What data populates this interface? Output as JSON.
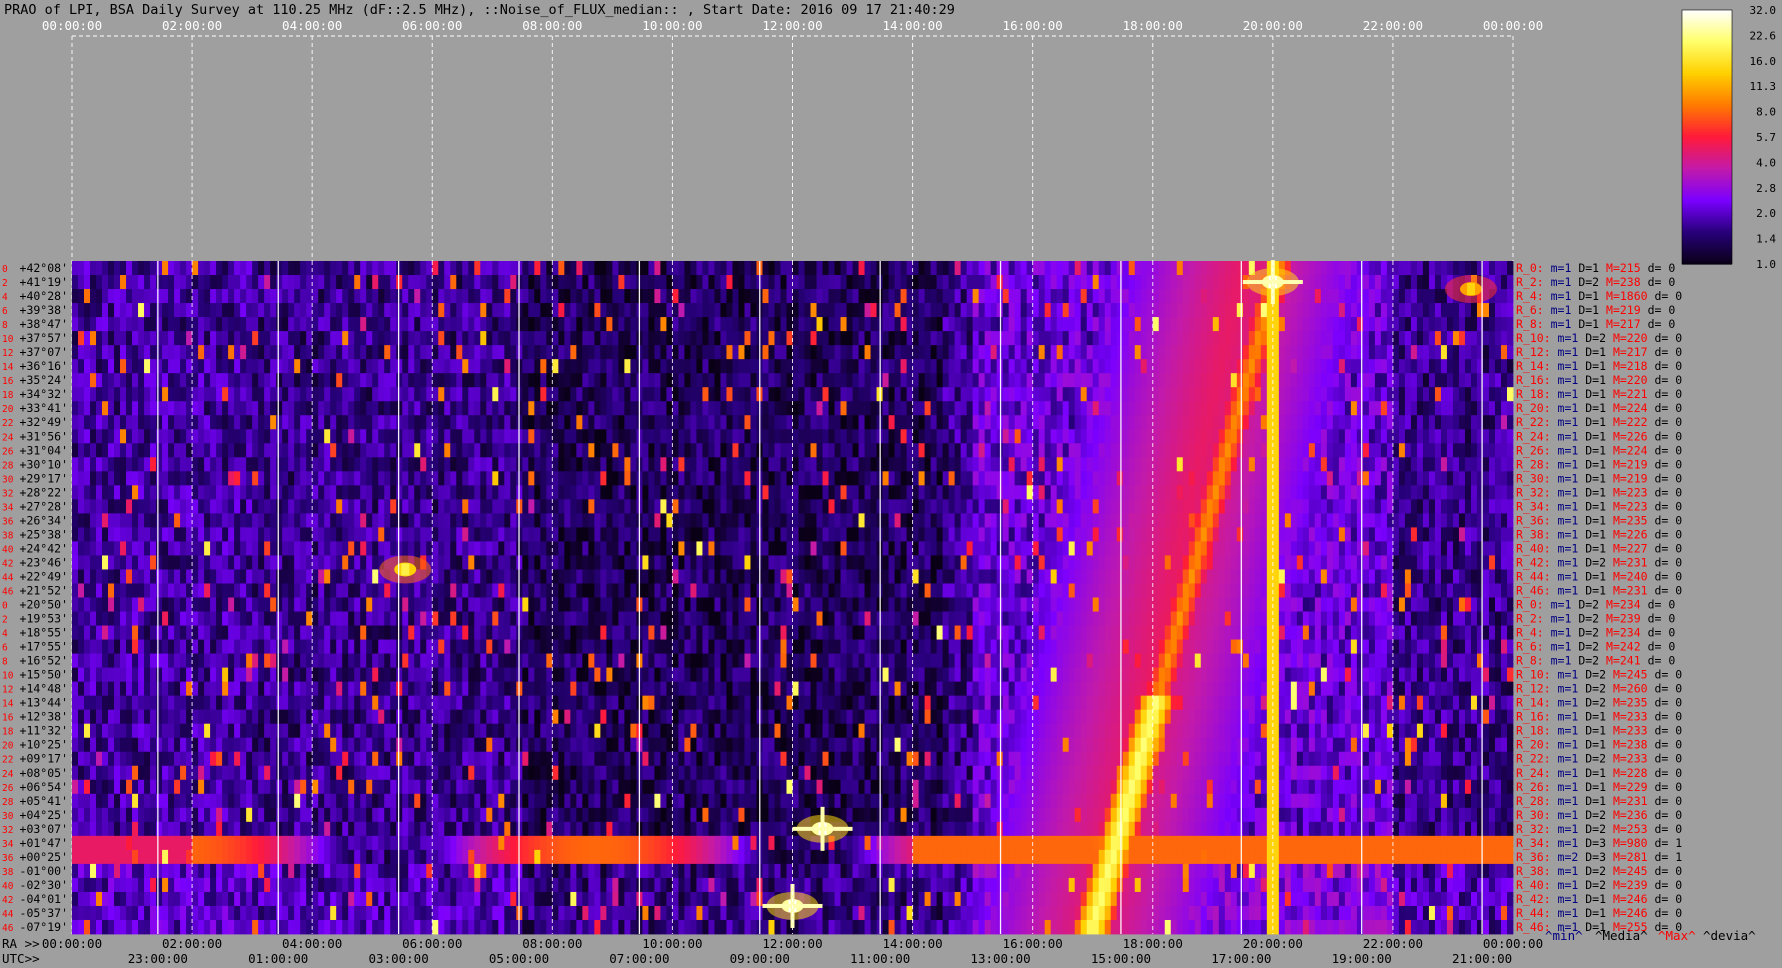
{
  "chart_data": {
    "type": "heatmap",
    "title": "PRAO of LPI, BSA Daily Survey at 110.25 MHz (dF::2.5 MHz), ::Noise_of_FLUX_median:: , Start Date: 2016 09 17 21:40:29",
    "top_ticks": [
      "00:00:00",
      "02:00:00",
      "04:00:00",
      "06:00:00",
      "08:00:00",
      "10:00:00",
      "12:00:00",
      "14:00:00",
      "16:00:00",
      "18:00:00",
      "20:00:00",
      "22:00:00",
      "00:00:00"
    ],
    "ra_label": "RA >>",
    "ra_ticks": [
      "00:00:00",
      "02:00:00",
      "04:00:00",
      "06:00:00",
      "08:00:00",
      "10:00:00",
      "12:00:00",
      "14:00:00",
      "16:00:00",
      "18:00:00",
      "20:00:00",
      "22:00:00",
      "00:00:00"
    ],
    "utc_label": "UTC>>",
    "utc_ticks": [
      "23:00:00",
      "01:00:00",
      "03:00:00",
      "05:00:00",
      "07:00:00",
      "09:00:00",
      "11:00:00",
      "13:00:00",
      "15:00:00",
      "17:00:00",
      "19:00:00",
      "21:00:00"
    ],
    "colorbar": {
      "ticks": [
        "32.0",
        "22.6",
        "16.0",
        "11.3",
        "8.0",
        "5.7",
        "4.0",
        "2.8",
        "2.0",
        "1.4",
        "1.0"
      ],
      "range": [
        1.0,
        32.0
      ],
      "scale": "log",
      "colors": [
        "#0a0016",
        "#27007a",
        "#7a00ff",
        "#c21aaa",
        "#ff1a3a",
        "#ff7a00",
        "#ffd000",
        "#ffff6a",
        "#ffffff"
      ]
    },
    "declinations": [
      "+42°08'",
      "+41°19'",
      "+40°28'",
      "+39°38'",
      "+38°47'",
      "+37°57'",
      "+37°07'",
      "+36°16'",
      "+35°24'",
      "+34°32'",
      "+33°41'",
      "+32°49'",
      "+31°56'",
      "+31°04'",
      "+30°10'",
      "+29°17'",
      "+28°22'",
      "+27°28'",
      "+26°34'",
      "+25°38'",
      "+24°42'",
      "+23°46'",
      "+22°49'",
      "+21°52'",
      "+20°50'",
      "+19°53'",
      "+18°55'",
      "+17°55'",
      "+16°52'",
      "+15°50'",
      "+14°48'",
      "+13°44'",
      "+12°38'",
      "+11°32'",
      "+10°25'",
      "+09°17'",
      "+08°05'",
      "+06°54'",
      "+05°41'",
      "+04°25'",
      "+03°07'",
      "+01°47'",
      "+00°25'",
      "-01°00'",
      "-02°30'",
      "-04°01'",
      "-05°37'",
      "-07°19'"
    ],
    "row_numbers": [
      "0",
      "2",
      "4",
      "6",
      "8",
      "10",
      "12",
      "14",
      "16",
      "18",
      "20",
      "22",
      "24",
      "26",
      "28",
      "30",
      "32",
      "34",
      "36",
      "38",
      "40",
      "42",
      "44",
      "46",
      "0",
      "2",
      "4",
      "6",
      "8",
      "10",
      "12",
      "14",
      "16",
      "18",
      "20",
      "22",
      "24",
      "26",
      "28",
      "30",
      "32",
      "34",
      "36",
      "38",
      "40",
      "42",
      "44",
      "46"
    ],
    "row_stats": [
      {
        "r": "R_0:",
        "m": "m=1",
        "d": "D=1",
        "M": "M=215",
        "dd": "d= 0"
      },
      {
        "r": "R_2:",
        "m": "m=1",
        "d": "D=2",
        "M": "M=238",
        "dd": "d= 0"
      },
      {
        "r": "R_4:",
        "m": "m=1",
        "d": "D=1",
        "M": "M=1860",
        "dd": "d= 0"
      },
      {
        "r": "R_6:",
        "m": "m=1",
        "d": "D=1",
        "M": "M=219",
        "dd": "d= 0"
      },
      {
        "r": "R_8:",
        "m": "m=1",
        "d": "D=1",
        "M": "M=217",
        "dd": "d= 0"
      },
      {
        "r": "R_10:",
        "m": "m=1",
        "d": "D=2",
        "M": "M=220",
        "dd": "d= 0"
      },
      {
        "r": "R_12:",
        "m": "m=1",
        "d": "D=1",
        "M": "M=217",
        "dd": "d= 0"
      },
      {
        "r": "R_14:",
        "m": "m=1",
        "d": "D=1",
        "M": "M=218",
        "dd": "d= 0"
      },
      {
        "r": "R_16:",
        "m": "m=1",
        "d": "D=1",
        "M": "M=220",
        "dd": "d= 0"
      },
      {
        "r": "R_18:",
        "m": "m=1",
        "d": "D=1",
        "M": "M=221",
        "dd": "d= 0"
      },
      {
        "r": "R_20:",
        "m": "m=1",
        "d": "D=1",
        "M": "M=224",
        "dd": "d= 0"
      },
      {
        "r": "R_22:",
        "m": "m=1",
        "d": "D=1",
        "M": "M=222",
        "dd": "d= 0"
      },
      {
        "r": "R_24:",
        "m": "m=1",
        "d": "D=1",
        "M": "M=226",
        "dd": "d= 0"
      },
      {
        "r": "R_26:",
        "m": "m=1",
        "d": "D=1",
        "M": "M=224",
        "dd": "d= 0"
      },
      {
        "r": "R_28:",
        "m": "m=1",
        "d": "D=1",
        "M": "M=219",
        "dd": "d= 0"
      },
      {
        "r": "R_30:",
        "m": "m=1",
        "d": "D=1",
        "M": "M=219",
        "dd": "d= 0"
      },
      {
        "r": "R_32:",
        "m": "m=1",
        "d": "D=1",
        "M": "M=223",
        "dd": "d= 0"
      },
      {
        "r": "R_34:",
        "m": "m=1",
        "d": "D=1",
        "M": "M=223",
        "dd": "d= 0"
      },
      {
        "r": "R_36:",
        "m": "m=1",
        "d": "D=1",
        "M": "M=235",
        "dd": "d= 0"
      },
      {
        "r": "R_38:",
        "m": "m=1",
        "d": "D=1",
        "M": "M=226",
        "dd": "d= 0"
      },
      {
        "r": "R_40:",
        "m": "m=1",
        "d": "D=1",
        "M": "M=227",
        "dd": "d= 0"
      },
      {
        "r": "R_42:",
        "m": "m=1",
        "d": "D=2",
        "M": "M=231",
        "dd": "d= 0"
      },
      {
        "r": "R_44:",
        "m": "m=1",
        "d": "D=1",
        "M": "M=240",
        "dd": "d= 0"
      },
      {
        "r": "R_46:",
        "m": "m=1",
        "d": "D=1",
        "M": "M=231",
        "dd": "d= 0"
      },
      {
        "r": "R_0:",
        "m": "m=1",
        "d": "D=2",
        "M": "M=234",
        "dd": "d= 0"
      },
      {
        "r": "R_2:",
        "m": "m=1",
        "d": "D=2",
        "M": "M=239",
        "dd": "d= 0"
      },
      {
        "r": "R_4:",
        "m": "m=1",
        "d": "D=2",
        "M": "M=234",
        "dd": "d= 0"
      },
      {
        "r": "R_6:",
        "m": "m=1",
        "d": "D=2",
        "M": "M=242",
        "dd": "d= 0"
      },
      {
        "r": "R_8:",
        "m": "m=1",
        "d": "D=2",
        "M": "M=241",
        "dd": "d= 0"
      },
      {
        "r": "R_10:",
        "m": "m=1",
        "d": "D=2",
        "M": "M=245",
        "dd": "d= 0"
      },
      {
        "r": "R_12:",
        "m": "m=1",
        "d": "D=2",
        "M": "M=260",
        "dd": "d= 0"
      },
      {
        "r": "R_14:",
        "m": "m=1",
        "d": "D=2",
        "M": "M=235",
        "dd": "d= 0"
      },
      {
        "r": "R_16:",
        "m": "m=1",
        "d": "D=1",
        "M": "M=233",
        "dd": "d= 0"
      },
      {
        "r": "R_18:",
        "m": "m=1",
        "d": "D=1",
        "M": "M=233",
        "dd": "d= 0"
      },
      {
        "r": "R_20:",
        "m": "m=1",
        "d": "D=1",
        "M": "M=238",
        "dd": "d= 0"
      },
      {
        "r": "R_22:",
        "m": "m=1",
        "d": "D=2",
        "M": "M=233",
        "dd": "d= 0"
      },
      {
        "r": "R_24:",
        "m": "m=1",
        "d": "D=1",
        "M": "M=228",
        "dd": "d= 0"
      },
      {
        "r": "R_26:",
        "m": "m=1",
        "d": "D=1",
        "M": "M=229",
        "dd": "d= 0"
      },
      {
        "r": "R_28:",
        "m": "m=1",
        "d": "D=1",
        "M": "M=231",
        "dd": "d= 0"
      },
      {
        "r": "R_30:",
        "m": "m=1",
        "d": "D=2",
        "M": "M=236",
        "dd": "d= 0"
      },
      {
        "r": "R_32:",
        "m": "m=1",
        "d": "D=2",
        "M": "M=253",
        "dd": "d= 0"
      },
      {
        "r": "R_34:",
        "m": "m=1",
        "d": "D=3",
        "M": "M=980",
        "dd": "d= 1"
      },
      {
        "r": "R_36:",
        "m": "m=2",
        "d": "D=3",
        "M": "M=281",
        "dd": "d= 1"
      },
      {
        "r": "R_38:",
        "m": "m=1",
        "d": "D=2",
        "M": "M=245",
        "dd": "d= 0"
      },
      {
        "r": "R_40:",
        "m": "m=1",
        "d": "D=2",
        "M": "M=239",
        "dd": "d= 0"
      },
      {
        "r": "R_42:",
        "m": "m=1",
        "d": "D=1",
        "M": "M=246",
        "dd": "d= 0"
      },
      {
        "r": "R_44:",
        "m": "m=1",
        "d": "D=1",
        "M": "M=246",
        "dd": "d= 0"
      },
      {
        "r": "R_46:",
        "m": "m=1",
        "d": "D=1",
        "M": "M=255",
        "dd": "d= 0"
      }
    ],
    "legend": [
      "^min^",
      "^Media^",
      "^Max^",
      "^devia^"
    ],
    "colors": {
      "background": "#9f9f9f",
      "stat_red": "#ff0000",
      "stat_blue": "#000080",
      "row_number": "#ff0000"
    },
    "features": [
      {
        "name": "horizontal source band",
        "dec_rows": [
          41,
          42
        ],
        "ra_start_h": 0.0,
        "ra_end_h": 24.0,
        "intensity": 8
      },
      {
        "name": "Cygnus track",
        "ra_h": 20.0,
        "dec_rows": [
          0,
          47
        ],
        "intensity": 14
      },
      {
        "name": "Cygnus A",
        "ra_h": 20.0,
        "dec_row": 1.5,
        "intensity": 32
      },
      {
        "name": "Taurus A",
        "ra_h": 5.55,
        "dec_row": 22,
        "intensity": 18
      },
      {
        "name": "Virgo A",
        "ra_h": 12.5,
        "dec_row": 40.5,
        "intensity": 32
      },
      {
        "name": "Cassiopeia A region",
        "ra_h": 23.3,
        "dec_row": 2,
        "intensity": 14
      },
      {
        "name": "Sun",
        "ra_h": 12.0,
        "dec_row": 46,
        "intensity": 32
      },
      {
        "name": "Galactic ridge",
        "ra_h": 17.2,
        "dec_rows": [
          30,
          47
        ],
        "intensity": 22
      }
    ]
  }
}
